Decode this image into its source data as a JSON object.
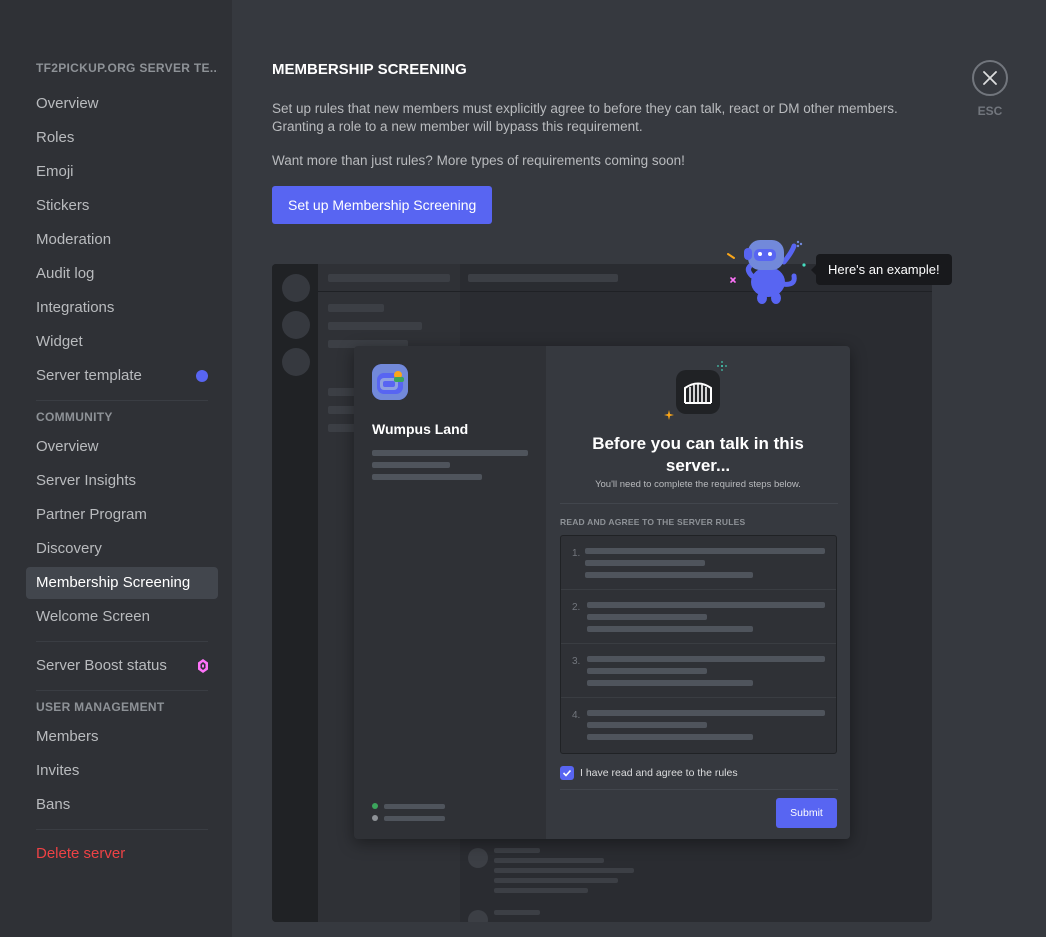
{
  "sidebar": {
    "server_header": "TF2PICKUP.ORG SERVER TE...",
    "server_items": [
      {
        "label": "Overview"
      },
      {
        "label": "Roles"
      },
      {
        "label": "Emoji"
      },
      {
        "label": "Stickers"
      },
      {
        "label": "Moderation"
      },
      {
        "label": "Audit log"
      },
      {
        "label": "Integrations"
      },
      {
        "label": "Widget"
      },
      {
        "label": "Server template"
      }
    ],
    "community_header": "COMMUNITY",
    "community_items": [
      {
        "label": "Overview"
      },
      {
        "label": "Server Insights"
      },
      {
        "label": "Partner Program"
      },
      {
        "label": "Discovery"
      },
      {
        "label": "Membership Screening"
      },
      {
        "label": "Welcome Screen"
      }
    ],
    "boost_label": "Server Boost status",
    "user_mgmt_header": "USER MANAGEMENT",
    "user_items": [
      {
        "label": "Members"
      },
      {
        "label": "Invites"
      },
      {
        "label": "Bans"
      }
    ],
    "delete_label": "Delete server",
    "active_item": "Membership Screening"
  },
  "main": {
    "title": "MEMBERSHIP SCREENING",
    "description": "Set up rules that new members must explicitly agree to before they can talk, react or DM other members. Granting a role to a new member will bypass this requirement.",
    "description2": "Want more than just rules? More types of requirements coming soon!",
    "setup_button": "Set up Membership Screening"
  },
  "close": {
    "label": "ESC"
  },
  "example": {
    "tooltip": "Here's an example!",
    "server_name": "Wumpus Land",
    "heading": "Before you can talk in this server...",
    "subheading": "You'll need to complete the required steps below.",
    "rules_header": "READ AND AGREE TO THE SERVER RULES",
    "rule_numbers": [
      "1.",
      "2.",
      "3.",
      "4."
    ],
    "agree_text": "I have read and agree to the rules",
    "agree_checked": true,
    "submit": "Submit"
  },
  "colors": {
    "accent": "#5865f2",
    "danger": "#ed4245",
    "boost_pink": "#ff73fa",
    "online_green": "#3ba55c"
  },
  "icons": [
    "close-icon",
    "gate-icon",
    "check-icon",
    "boost-gem-icon",
    "wumpus-mascot"
  ]
}
